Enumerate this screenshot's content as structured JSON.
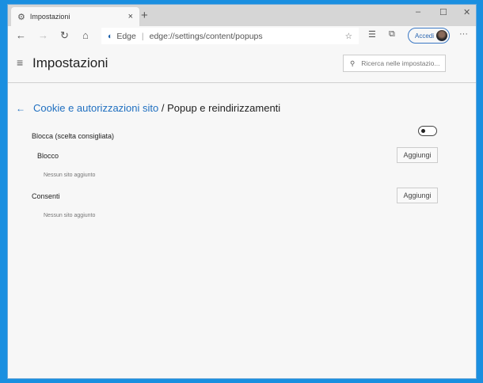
{
  "tab": {
    "title": "Impostazioni",
    "close": "×",
    "new": "+",
    "icon": "gear-icon"
  },
  "window_controls": {
    "minimize": "–",
    "maximize": "☐",
    "close": "✕"
  },
  "toolbar": {
    "back": "←",
    "forward": "→",
    "refresh": "↻",
    "home": "⌂",
    "brand": "Edge",
    "url": "edge://settings/content/popups",
    "favorite": "☆",
    "favorites": "☰",
    "collections": "⧉",
    "signin": "Accedi",
    "more": "···"
  },
  "header": {
    "menu": "≡",
    "title": "Impostazioni",
    "search_placeholder": "Ricerca nelle impostazio..."
  },
  "breadcrumb": {
    "back": "←",
    "parent": "Cookie e autorizzazioni sito",
    "sep": " / ",
    "current": "Popup e reindirizzamenti"
  },
  "block_toggle": {
    "label": "Blocca (scelta consigliata)",
    "enabled": false
  },
  "sections": [
    {
      "label": "Blocco",
      "button": "Aggiungi",
      "empty": "Nessun sito aggiunto"
    },
    {
      "label": "Consenti",
      "button": "Aggiungi",
      "empty": "Nessun sito aggiunto"
    }
  ]
}
